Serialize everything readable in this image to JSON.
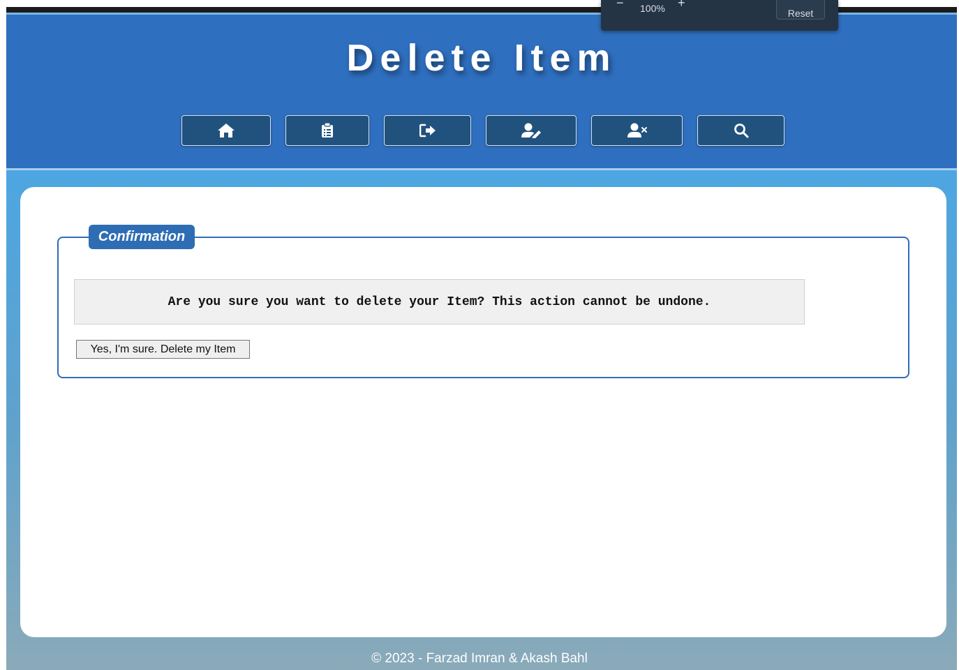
{
  "browser": {
    "zoom_minus": "−",
    "zoom_level": "100%",
    "zoom_plus": "+",
    "zoom_reset": "Reset"
  },
  "header": {
    "title": "Delete Item"
  },
  "nav": {
    "items": [
      {
        "name": "home",
        "icon": "home-icon"
      },
      {
        "name": "clipboard",
        "icon": "clipboard-list-icon"
      },
      {
        "name": "sign-out",
        "icon": "sign-out-icon"
      },
      {
        "name": "edit-user",
        "icon": "user-edit-icon"
      },
      {
        "name": "delete-user",
        "icon": "user-times-icon"
      },
      {
        "name": "search",
        "icon": "search-icon"
      }
    ]
  },
  "confirmation": {
    "legend": "Confirmation",
    "message": "Are you sure you want to delete your Item? This action cannot be undone.",
    "button_label": "Yes, I'm sure. Delete my Item"
  },
  "footer": {
    "text": "© 2023 - Farzad Imran & Akash Bahl"
  },
  "colors": {
    "header_bg": "#2f6fbf",
    "nav_button_bg": "#21527e",
    "accent": "#2e6db4"
  }
}
